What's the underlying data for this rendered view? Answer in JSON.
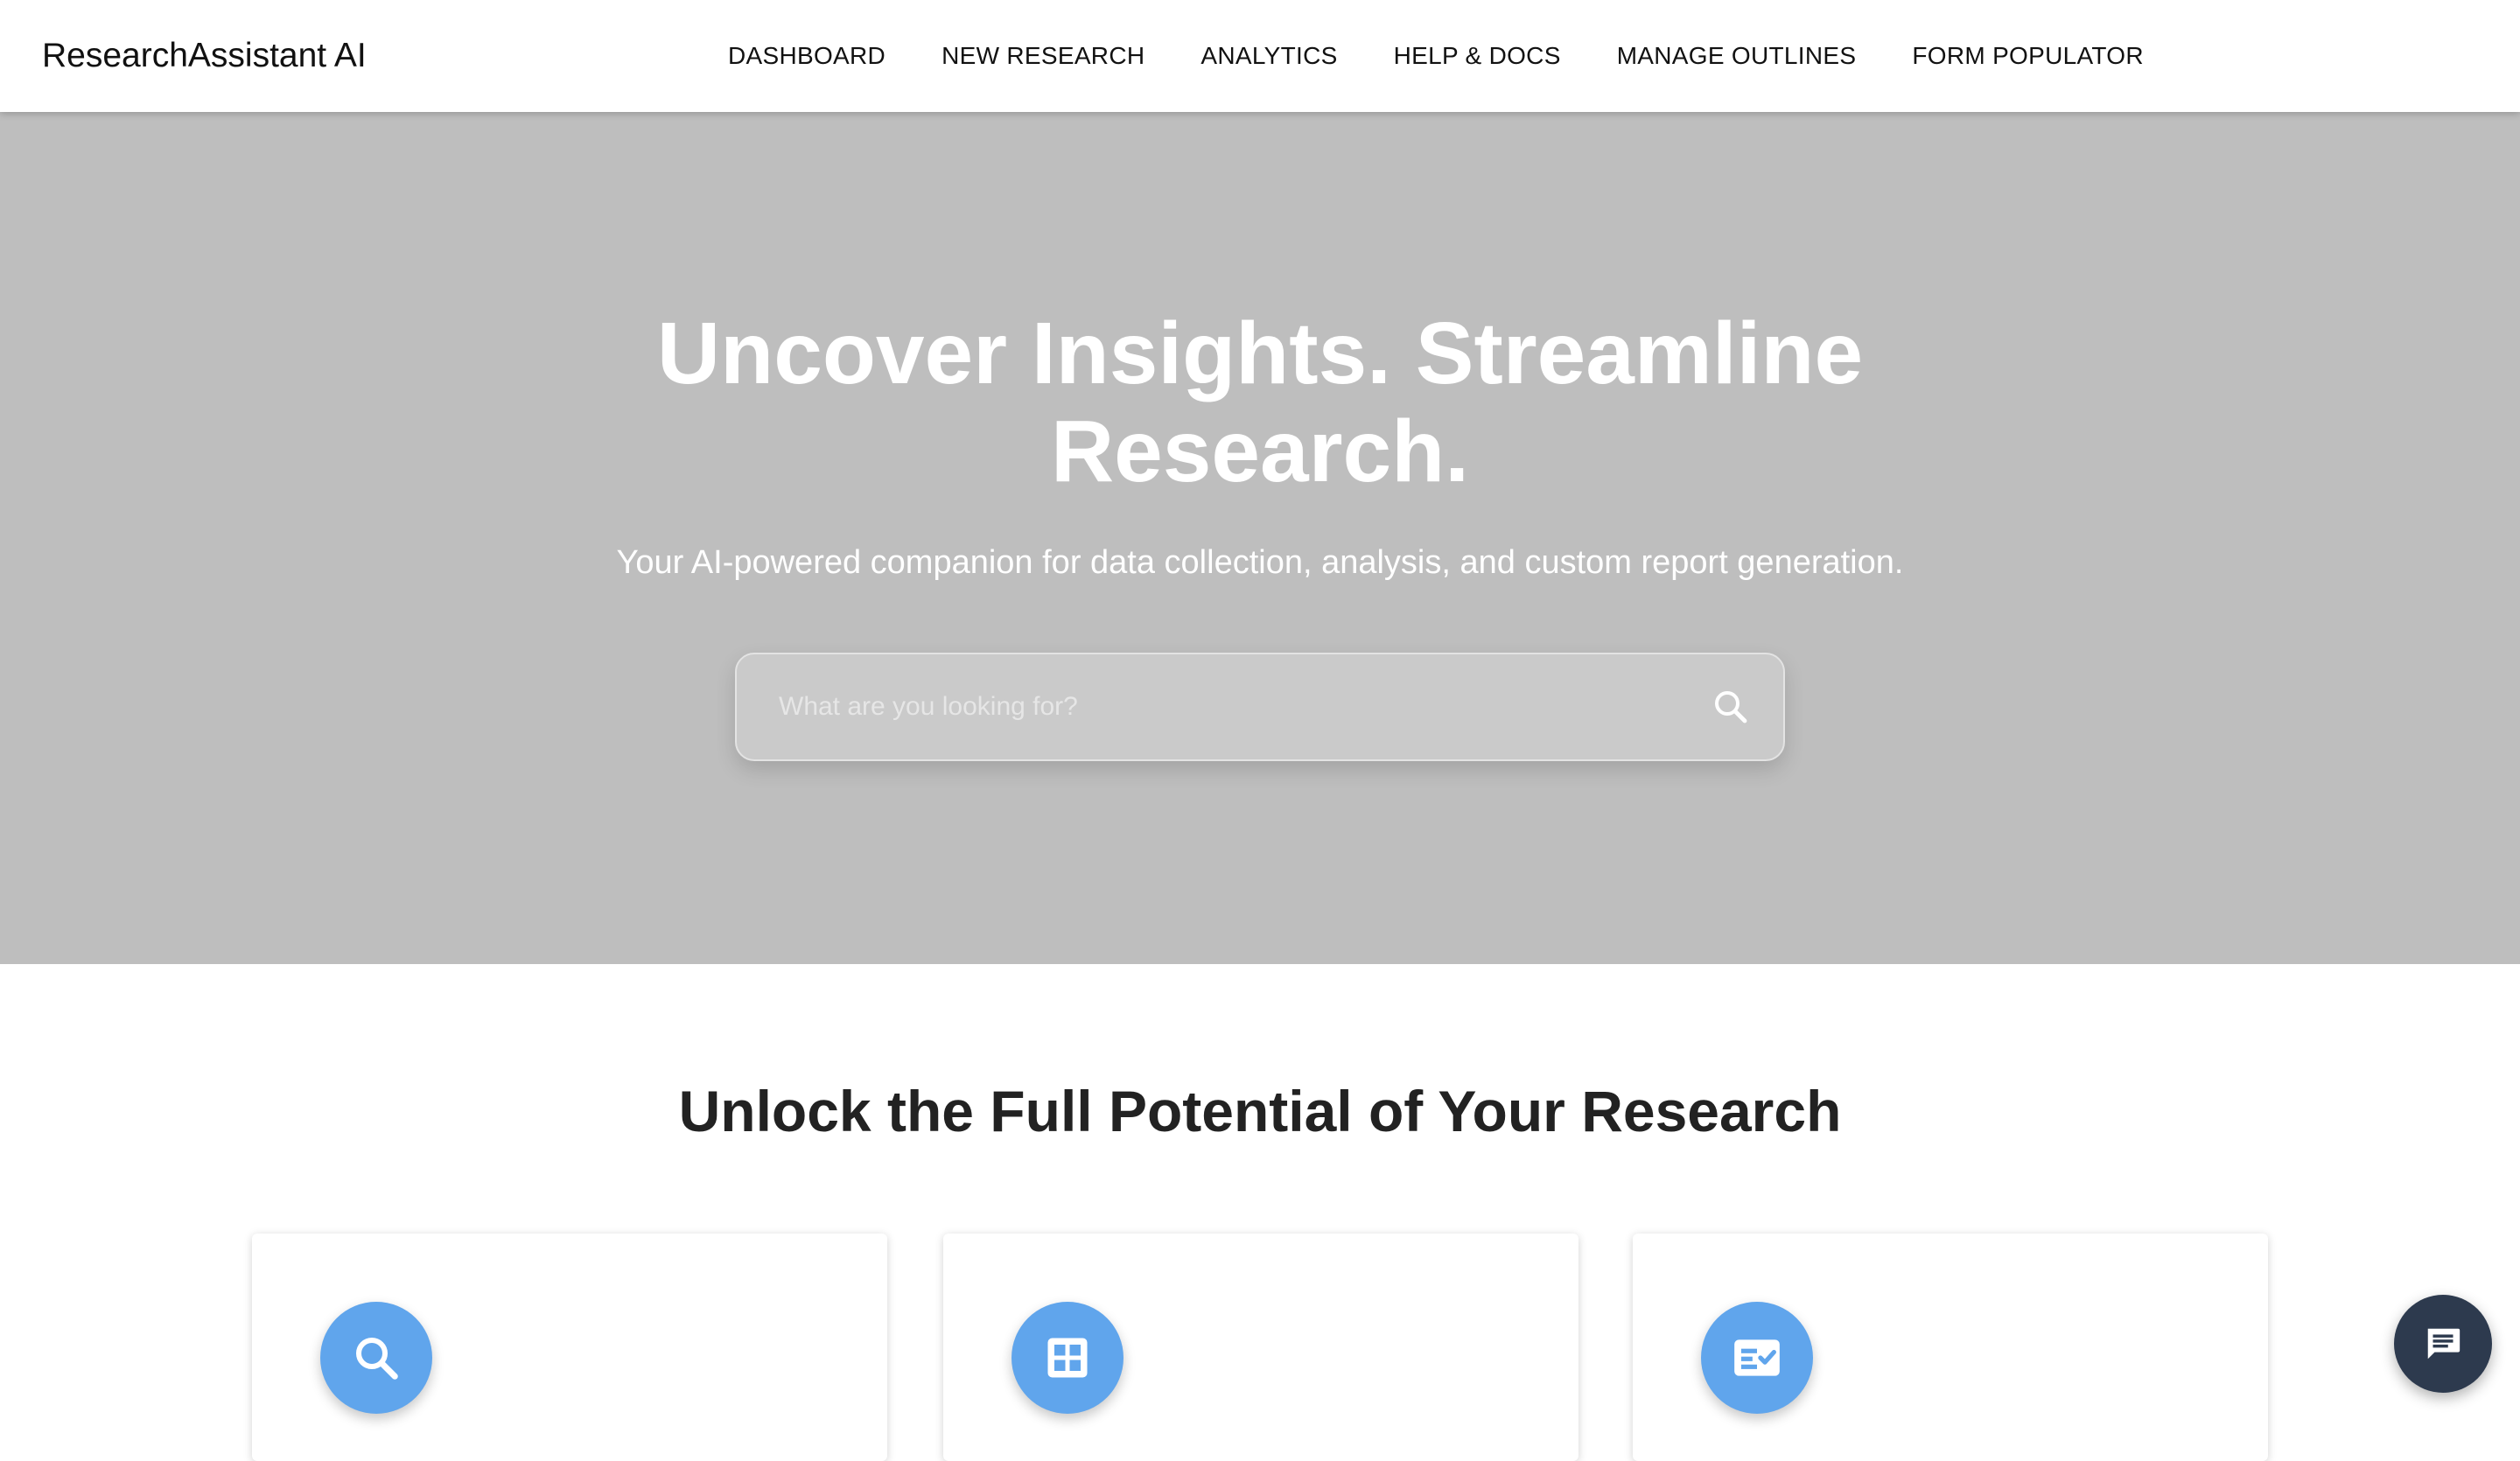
{
  "header": {
    "brand": "ResearchAssistant AI",
    "nav": [
      {
        "label": "DASHBOARD"
      },
      {
        "label": "NEW RESEARCH"
      },
      {
        "label": "ANALYTICS"
      },
      {
        "label": "HELP & DOCS"
      },
      {
        "label": "MANAGE OUTLINES"
      },
      {
        "label": "FORM POPULATOR"
      }
    ]
  },
  "hero": {
    "title_line1": "Uncover Insights. Streamline",
    "title_line2": "Research.",
    "subtitle": "Your AI-powered companion for data collection, analysis, and custom report generation.",
    "search": {
      "placeholder": "What are you looking for?",
      "value": "",
      "icon": "search-icon"
    }
  },
  "features": {
    "title": "Unlock the Full Potential of Your Research",
    "cards": [
      {
        "icon": "search-icon"
      },
      {
        "icon": "grid-icon"
      },
      {
        "icon": "checklist-icon"
      }
    ]
  },
  "chat": {
    "icon": "chat-icon"
  },
  "colors": {
    "hero_background": "#bebebe",
    "accent": "#60a5ec",
    "chat_button": "#2d3a4e",
    "text_dark": "#222222"
  }
}
